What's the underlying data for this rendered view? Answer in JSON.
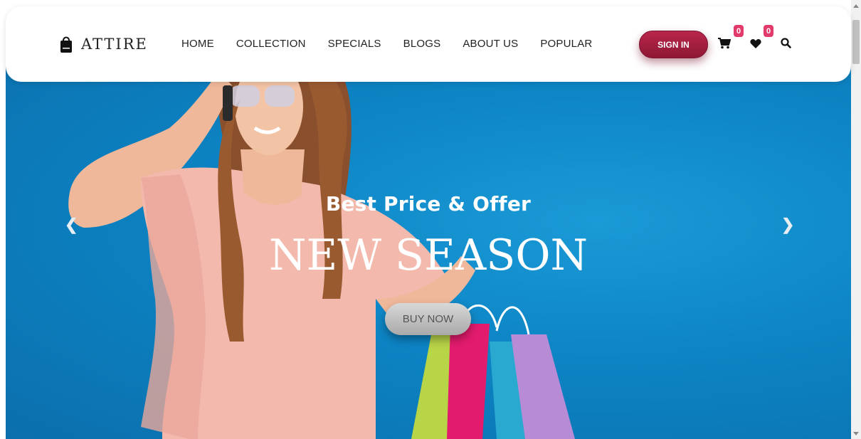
{
  "brand": {
    "name": "ATTIRE",
    "icon": "shopping-bag-icon"
  },
  "nav": {
    "items": [
      {
        "label": "HOME"
      },
      {
        "label": "COLLECTION"
      },
      {
        "label": "SPECIALS"
      },
      {
        "label": "BLOGS"
      },
      {
        "label": "ABOUT US"
      },
      {
        "label": "POPULAR"
      }
    ]
  },
  "header": {
    "signin_label": "SIGN IN",
    "cart": {
      "icon": "cart-icon",
      "count": "0"
    },
    "wishlist": {
      "icon": "heart-icon",
      "count": "0"
    },
    "search": {
      "icon": "search-icon"
    }
  },
  "hero": {
    "subtitle": "Best Price & Offer",
    "title": "NEW SEASON",
    "cta_label": "BUY NOW",
    "prev_icon": "chevron-left-icon",
    "next_icon": "chevron-right-icon"
  },
  "colors": {
    "hero_bg": "#0d84c4",
    "signin_bg": "#a41e42",
    "badge_bg": "#e23a6a",
    "dress": "#f3b9ad"
  }
}
